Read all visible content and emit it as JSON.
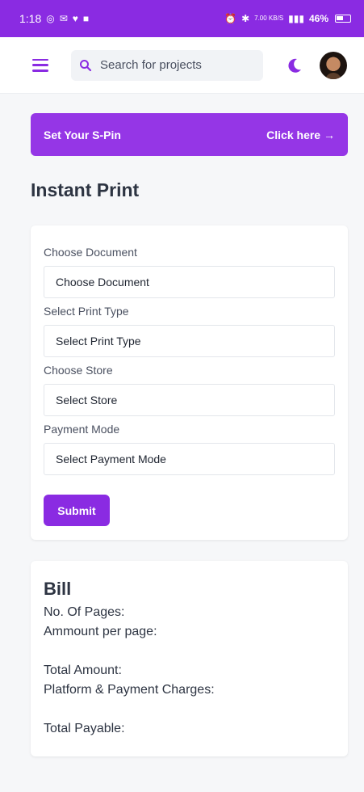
{
  "status_bar": {
    "time": "1:18",
    "net_speed": "7.00 KB/S",
    "battery_percent": "46%",
    "color": "#8a2be2"
  },
  "nav": {
    "search_placeholder": "Search for projects",
    "icons": [
      "menu-icon",
      "search-icon",
      "moon-icon",
      "avatar"
    ]
  },
  "banner": {
    "label": "Set Your S-Pin",
    "link": "Click here →",
    "color": "#9536e6"
  },
  "page_title": "Instant Print",
  "form": {
    "fields": [
      {
        "label": "Choose Document",
        "value": "Choose Document"
      },
      {
        "label": "Select Print Type",
        "value": "Select Print Type"
      },
      {
        "label": "Choose Store",
        "value": "Select Store"
      },
      {
        "label": "Payment Mode",
        "value": "Select Payment Mode"
      }
    ],
    "submit_label": "Submit"
  },
  "bill": {
    "title": "Bill",
    "pages_label": "No. Of Pages:",
    "amount_per_page_label": "Ammount per page:",
    "total_amount_label": "Total Amount:",
    "charges_label": "Platform & Payment Charges:",
    "total_payable_label": "Total Payable:"
  }
}
